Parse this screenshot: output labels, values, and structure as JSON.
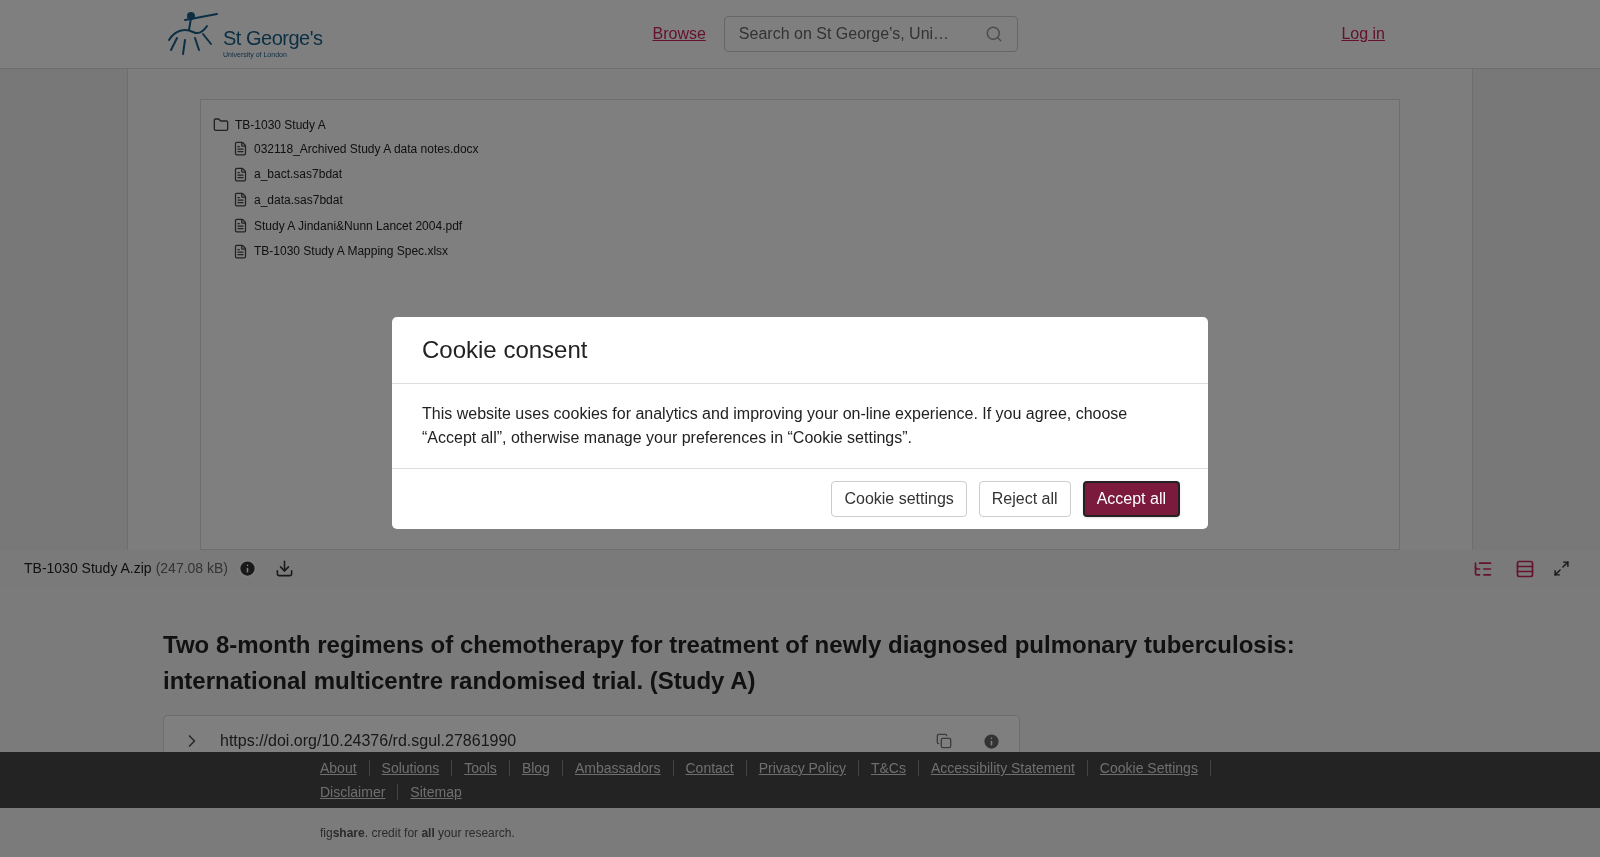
{
  "header": {
    "logo": {
      "name": "St George's",
      "subtitle": "University of London"
    },
    "nav_link": "Browse",
    "search": {
      "placeholder": "Search on St George's, Uni…"
    },
    "login": "Log in"
  },
  "viewer": {
    "tree": {
      "name": "TB-1030 Study A",
      "children": [
        {
          "name": "032118_Archived Study A data notes.docx"
        },
        {
          "name": "a_bact.sas7bdat"
        },
        {
          "name": "a_data.sas7bdat"
        },
        {
          "name": "Study A Jindani&Nunn Lancet 2004.pdf"
        },
        {
          "name": "TB-1030 Study A Mapping Spec.xlsx"
        }
      ]
    },
    "file_bar": {
      "filename": "TB-1030 Study A.zip",
      "size": "(247.08 kB)"
    }
  },
  "article": {
    "title": "Two 8-month regimens of chemotherapy for treatment of newly diagnosed pulmonary tuberculosis: international multicentre randomised trial. (Study A)",
    "doi": "https://doi.org/10.24376/rd.sgul.27861990"
  },
  "footer": {
    "links": [
      "About",
      "Solutions",
      "Tools",
      "Blog",
      "Ambassadors",
      "Contact",
      "Privacy Policy",
      "T&Cs",
      "Accessibility Statement",
      "Cookie Settings",
      "Disclaimer",
      "Sitemap"
    ],
    "tagline": "fig**share**. credit for **all** your research."
  },
  "cookie_dialog": {
    "title": "Cookie consent",
    "body": "This website uses cookies for analytics and improving your on-line experience. If you agree, choose “Accept all”, otherwise manage your preferences in “Cookie settings”.",
    "buttons": [
      {
        "label": "Cookie settings",
        "kind": "secondary"
      },
      {
        "label": "Reject all",
        "kind": "secondary"
      },
      {
        "label": "Accept all",
        "kind": "primary"
      }
    ]
  }
}
